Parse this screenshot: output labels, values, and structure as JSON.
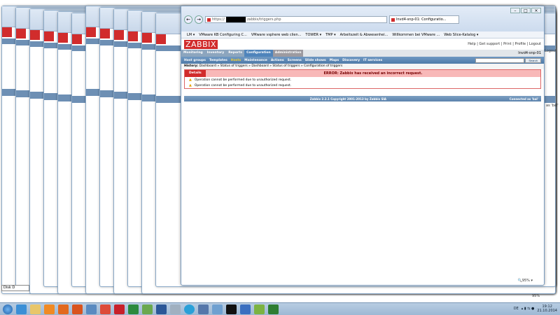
{
  "browser": {
    "address": "https://",
    "address_suffix": "zabbix/triggers.php",
    "tab_label": "lnvd4-snp-01: Configuratio...",
    "favorites": [
      "LM ▾",
      "VMware KB Configuring C...",
      "VMware vsphere web clien...",
      "TOWER ▾",
      "TMP ▾",
      "Arbeitszeit & Abwesenhei...",
      "",
      "Willkommen bei VMware ...",
      "Web Slice-Katalog ▾"
    ],
    "zoom": "95%"
  },
  "zabbix": {
    "logo": "ZABBIX",
    "top_links": "Help | Get support | Print | Profile | Logout",
    "main_menu": [
      "Monitoring",
      "Inventory",
      "Reports",
      "Configuration",
      "Administration"
    ],
    "active_main": "Configuration",
    "server_name": "lnvd4-snp-01",
    "sub_menu": [
      "Host groups",
      "Templates",
      "Hosts",
      "Maintenance",
      "Actions",
      "Screens",
      "Slide shows",
      "Maps",
      "Discovery",
      "IT services"
    ],
    "active_sub": "Hosts",
    "search_button": "Search",
    "history_label": "History:",
    "history": "Dashboard » Status of triggers » Dashboard » Status of triggers » Configuration of triggers",
    "details_label": "Details",
    "error_title": "ERROR: Zabbix has received an incorrect request.",
    "messages": [
      "Operation cannot be performed due to unauthorized request.",
      "Operation cannot be performed due to unauthorized request."
    ],
    "footer": "Zabbix 2.2.1 Copyright 2001-2013 by Zabbix SIA",
    "connected": "Connected as 'bal'"
  },
  "background": {
    "disk_label": "Disk D",
    "side_logout": "Logout",
    "side_search": "Search",
    "side_connected": "as 'bal'"
  },
  "tray": {
    "lang": "DE",
    "time": "19:12",
    "date": "21.10.2014"
  },
  "colors": {
    "zabbix_red": "#d12c2c",
    "nav_blue": "#4f7aa8",
    "error_bg": "#f8b8b8"
  }
}
